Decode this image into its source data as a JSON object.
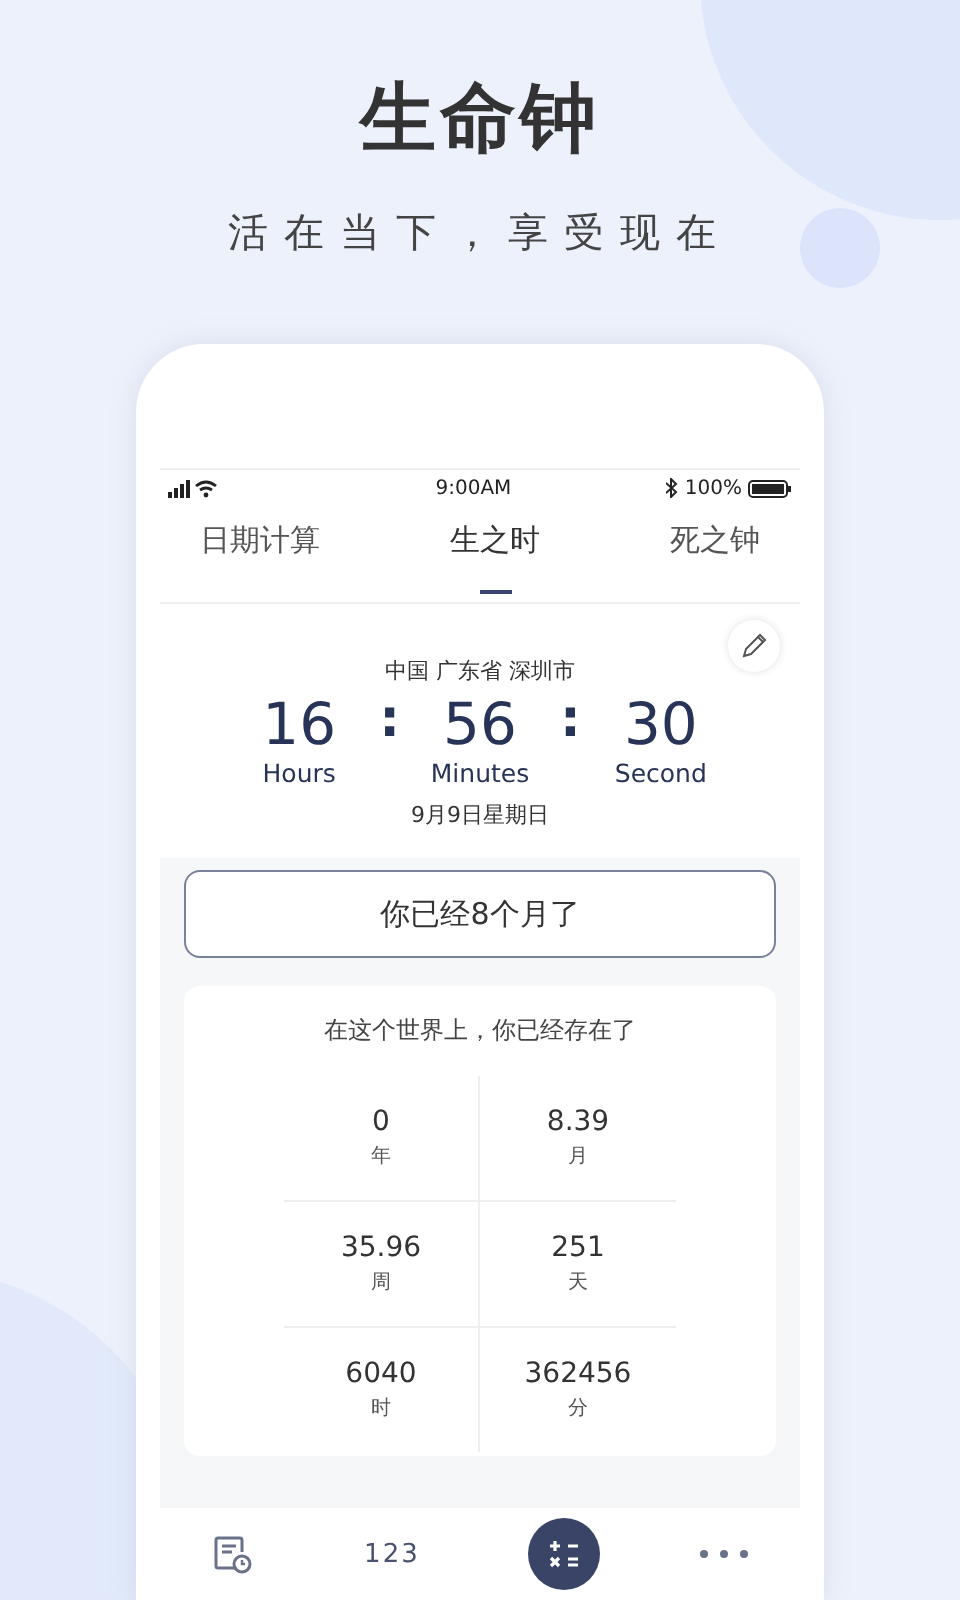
{
  "headline": {
    "title": "生命钟",
    "subtitle": "活在当下，享受现在"
  },
  "status_bar": {
    "time": "9:00AM",
    "battery": "100%"
  },
  "tabs": [
    {
      "label": "日期计算",
      "selected": false
    },
    {
      "label": "生之时",
      "selected": true
    },
    {
      "label": "死之钟",
      "selected": false
    }
  ],
  "clock": {
    "location": "中国 广东省 深圳市",
    "units": [
      {
        "value": "16",
        "label": "Hours"
      },
      {
        "value": "56",
        "label": "Minutes"
      },
      {
        "value": "30",
        "label": "Second"
      }
    ],
    "separator": ":",
    "date": "9月9日星期日"
  },
  "age_button": "你已经8个月了",
  "stats": {
    "title": "在这个世界上，你已经存在了",
    "items": [
      {
        "value": "0",
        "unit": "年"
      },
      {
        "value": "8.39",
        "unit": "月"
      },
      {
        "value": "35.96",
        "unit": "周"
      },
      {
        "value": "251",
        "unit": "天"
      },
      {
        "value": "6040",
        "unit": "时"
      },
      {
        "value": "362456",
        "unit": "分"
      }
    ]
  },
  "bottom_nav": [
    {
      "kind": "calendar"
    },
    {
      "kind": "text",
      "label": "123"
    },
    {
      "kind": "calculator"
    },
    {
      "kind": "more"
    }
  ]
}
